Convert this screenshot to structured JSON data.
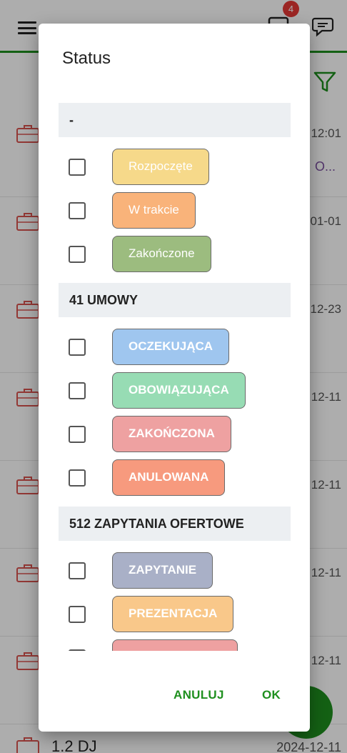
{
  "appbar": {
    "badge_count": "4"
  },
  "list": {
    "rows": [
      {
        "date": "12:01",
        "extra": "O..."
      },
      {
        "date": "01-01",
        "extra": ""
      },
      {
        "date": "12-23",
        "extra": ""
      },
      {
        "date": "12-11",
        "extra": ""
      },
      {
        "date": "12-11",
        "extra": ""
      },
      {
        "date": "12-11",
        "extra": ""
      },
      {
        "date": "12-11",
        "extra": ""
      }
    ],
    "last_row": {
      "title": "1.2 DJ",
      "date": "2024-12-11"
    }
  },
  "dialog": {
    "title": "Status",
    "groups": [
      {
        "header": "-",
        "options": [
          {
            "label": "Rozpoczęte",
            "color": "#f6d98a"
          },
          {
            "label": "W trakcie",
            "color": "#f9b37a"
          },
          {
            "label": "Zakończone",
            "color": "#9cbc7f"
          }
        ]
      },
      {
        "header": "41 UMOWY",
        "options": [
          {
            "label": "OCZEKUJĄCA",
            "color": "#9fc6ef"
          },
          {
            "label": "OBOWIĄZUJĄCA",
            "color": "#97dcb4"
          },
          {
            "label": "ZAKOŃCZONA",
            "color": "#eea1a1"
          },
          {
            "label": "ANULOWANA",
            "color": "#f79a7e"
          }
        ]
      },
      {
        "header": "512 ZAPYTANIA OFERTOWE",
        "options": [
          {
            "label": "ZAPYTANIE",
            "color": "#a9b0c7"
          },
          {
            "label": "PREZENTACJA",
            "color": "#f9c88a"
          },
          {
            "label": "",
            "color": "#eea1a1"
          }
        ]
      }
    ],
    "cancel_label": "ANULUJ",
    "ok_label": "OK",
    "accent_color": "#1e8f1e"
  }
}
